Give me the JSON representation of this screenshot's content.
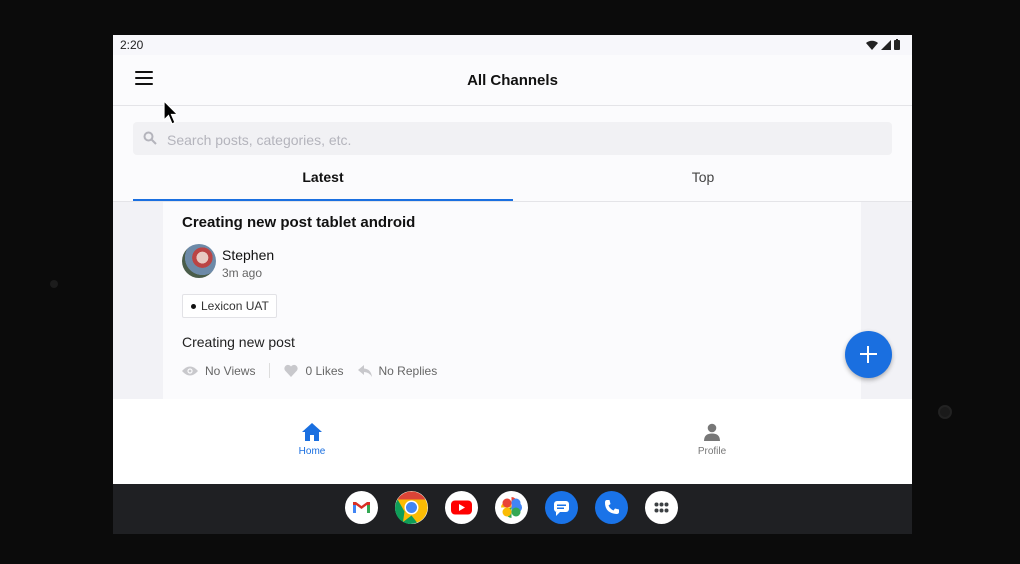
{
  "status_bar": {
    "time": "2:20"
  },
  "app_bar": {
    "title": "All Channels"
  },
  "search": {
    "placeholder": "Search posts, categories, etc."
  },
  "tabs": [
    {
      "label": "Latest",
      "selected": true
    },
    {
      "label": "Top",
      "selected": false
    }
  ],
  "post": {
    "title": "Creating new post tablet android",
    "author": "Stephen",
    "time": "3m ago",
    "tag": "Lexicon UAT",
    "body": "Creating new post",
    "views": "No Views",
    "likes": "0 Likes",
    "replies": "No Replies"
  },
  "bottom_nav": [
    {
      "label": "Home",
      "icon": "home-icon",
      "active": true
    },
    {
      "label": "Profile",
      "icon": "person-icon",
      "active": false
    }
  ],
  "dock_apps": [
    "gmail-icon",
    "chrome-icon",
    "youtube-icon",
    "photos-icon",
    "messages-icon",
    "phone-icon",
    "app-drawer-icon"
  ],
  "colors": {
    "accent": "#1a6fe0",
    "taskbar": "#1f2023"
  }
}
